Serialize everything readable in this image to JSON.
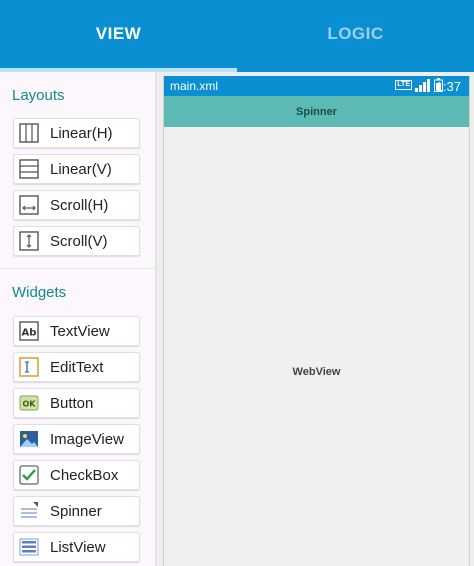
{
  "tabs": {
    "view": "VIEW",
    "logic": "LOGIC"
  },
  "palette": {
    "layouts_title": "Layouts",
    "layouts": [
      {
        "label": "Linear(H)",
        "icon": "linear-horizontal-icon"
      },
      {
        "label": "Linear(V)",
        "icon": "linear-vertical-icon"
      },
      {
        "label": "Scroll(H)",
        "icon": "scroll-horizontal-icon"
      },
      {
        "label": "Scroll(V)",
        "icon": "scroll-vertical-icon"
      }
    ],
    "widgets_title": "Widgets",
    "widgets": [
      {
        "label": "TextView",
        "icon": "textview-icon",
        "glyph": "Ab"
      },
      {
        "label": "EditText",
        "icon": "edittext-icon"
      },
      {
        "label": "Button",
        "icon": "button-icon",
        "glyph": "OK"
      },
      {
        "label": "ImageView",
        "icon": "imageview-icon"
      },
      {
        "label": "CheckBox",
        "icon": "checkbox-icon"
      },
      {
        "label": "Spinner",
        "icon": "spinner-icon"
      },
      {
        "label": "ListView",
        "icon": "listview-icon"
      }
    ]
  },
  "preview": {
    "file_name": "main.xml",
    "status_badge": "LTE",
    "time": "1:37",
    "spinner_label": "Spinner",
    "webview_label": "WebView"
  },
  "colors": {
    "accent": "#0a8fd3",
    "section_title": "#138a8a",
    "spinner_bar": "#5db9b4"
  }
}
